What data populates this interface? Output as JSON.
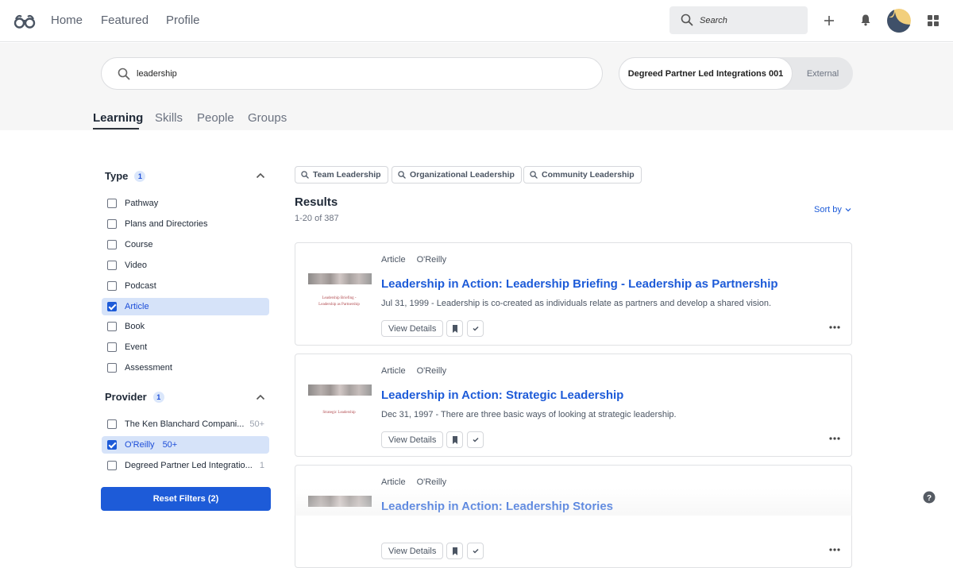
{
  "topnav": {
    "logo_icon": "glasses-logo-icon",
    "links": [
      "Home",
      "Featured",
      "Profile"
    ],
    "search_placeholder": "Search",
    "icons": [
      "search-icon",
      "plus-icon",
      "bell-icon",
      "avatar",
      "apps-grid-icon"
    ]
  },
  "search": {
    "query": "leadership",
    "scope_options": [
      "Degreed Partner Led Integrations 001",
      "External"
    ],
    "scope_selected": "Degreed Partner Led Integrations 001"
  },
  "tabs": [
    {
      "label": "Learning",
      "active": true
    },
    {
      "label": "Skills",
      "active": false
    },
    {
      "label": "People",
      "active": false
    },
    {
      "label": "Groups",
      "active": false
    }
  ],
  "filters": {
    "type": {
      "title": "Type",
      "count": "1",
      "options": [
        {
          "label": "Pathway",
          "checked": false
        },
        {
          "label": "Plans and Directories",
          "checked": false
        },
        {
          "label": "Course",
          "checked": false
        },
        {
          "label": "Video",
          "checked": false
        },
        {
          "label": "Podcast",
          "checked": false
        },
        {
          "label": "Article",
          "checked": true
        },
        {
          "label": "Book",
          "checked": false
        },
        {
          "label": "Event",
          "checked": false
        },
        {
          "label": "Assessment",
          "checked": false
        }
      ]
    },
    "provider": {
      "title": "Provider",
      "count": "1",
      "options": [
        {
          "label": "The Ken Blanchard Compani...",
          "count": "50+",
          "checked": false
        },
        {
          "label": "O'Reilly",
          "count": "50+",
          "checked": true
        },
        {
          "label": "Degreed Partner Led Integratio...",
          "count": "1",
          "checked": false
        }
      ]
    },
    "reset_label": "Reset Filters (2)"
  },
  "suggestions": [
    "Team Leadership",
    "Organizational Leadership",
    "Community Leadership"
  ],
  "results": {
    "title": "Results",
    "range": "1-20 of 387",
    "sort_label": "Sort by",
    "items": [
      {
        "type": "Article",
        "provider": "O'Reilly",
        "title": "Leadership in Action: Leadership Briefing - Leadership as Partnership",
        "description": "Jul 31, 1999 - Leadership is co-created as individuals relate as partners and develop a shared vision.",
        "thumb_caption": [
          "Leadership Briefing -",
          "Leadership as Partnership"
        ],
        "view_label": "View Details"
      },
      {
        "type": "Article",
        "provider": "O'Reilly",
        "title": "Leadership in Action: Strategic Leadership",
        "description": "Dec 31, 1997 - There are three basic ways of looking at strategic leadership.",
        "thumb_caption": [
          "Strategic Leadership"
        ],
        "view_label": "View Details"
      },
      {
        "type": "Article",
        "provider": "O'Reilly",
        "title": "Leadership in Action: Leadership Stories",
        "description": "",
        "thumb_caption": [],
        "view_label": "View Details"
      }
    ]
  },
  "colors": {
    "accent": "#1d5bd8",
    "selected_bg": "#d6e3f9",
    "hero_bg": "#f6f6f6"
  }
}
